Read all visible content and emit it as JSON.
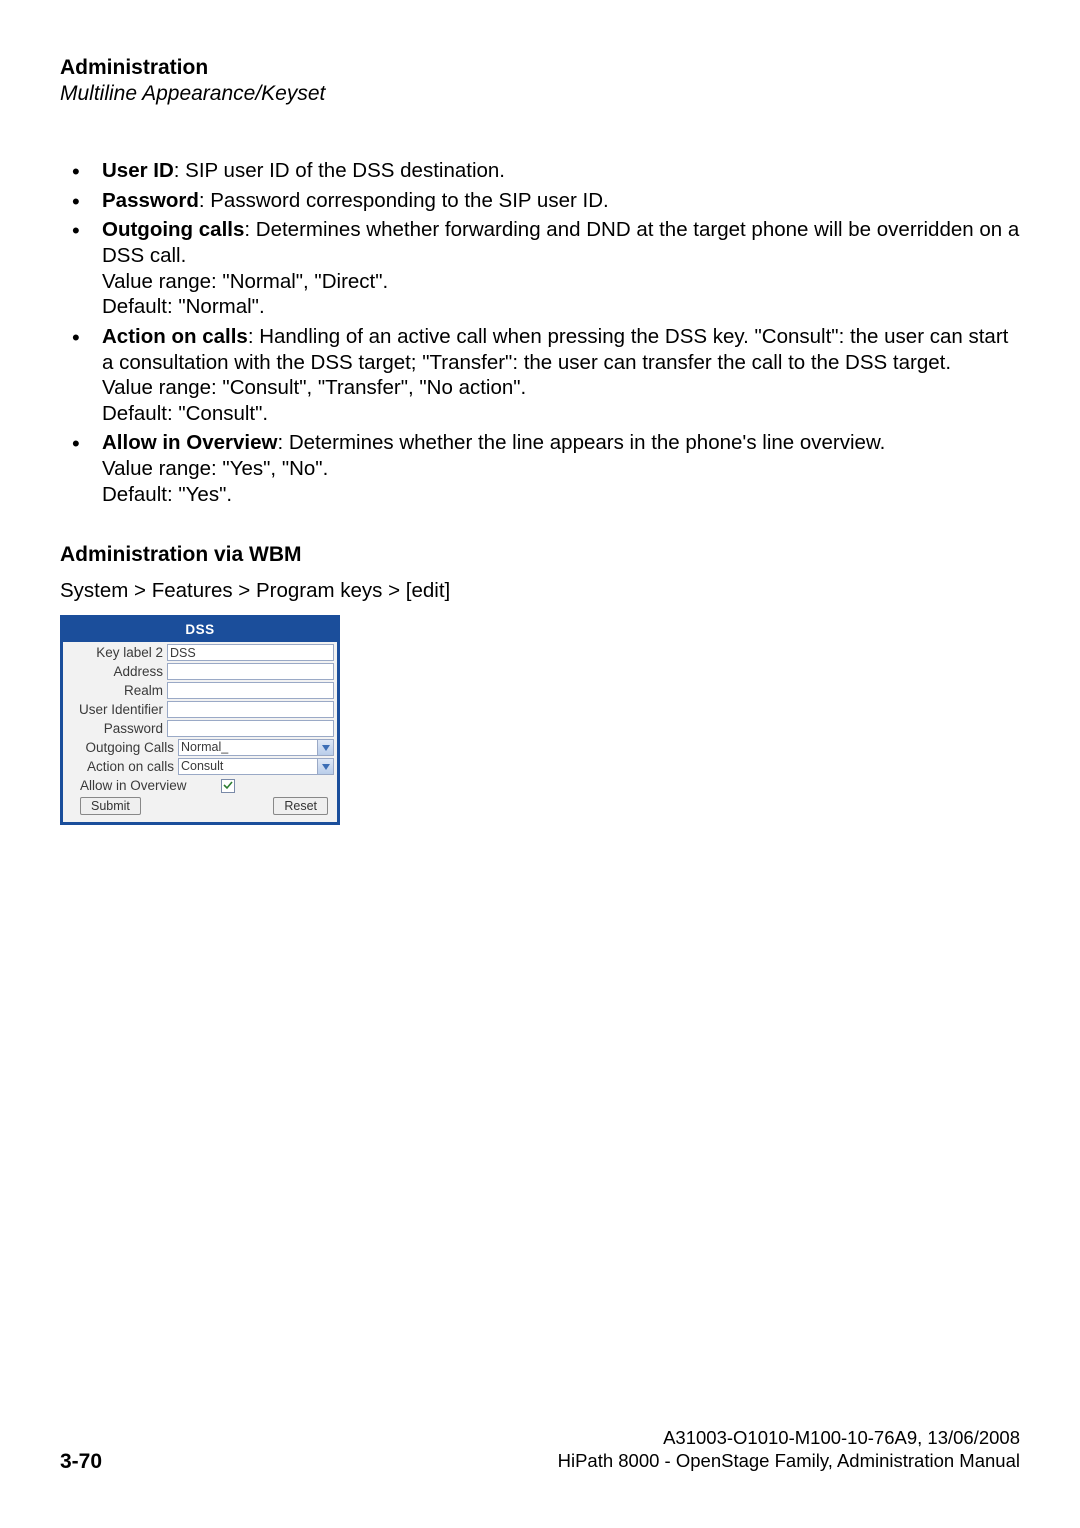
{
  "header": {
    "title": "Administration",
    "subtitle": "Multiline Appearance/Keyset"
  },
  "bullets": [
    {
      "title": "User ID",
      "body": ": SIP user ID of the DSS destination."
    },
    {
      "title": "Password",
      "body": ": Password corresponding to the SIP user ID."
    },
    {
      "title": "Outgoing calls",
      "body": ": Determines whether forwarding and DND at the target phone will be overridden on a DSS call.\nValue range: \"Normal\", \"Direct\".\nDefault: \"Normal\"."
    },
    {
      "title": "Action on calls",
      "body": ": Handling of an active call when pressing the DSS key. \"Consult\": the user can start a consultation with the DSS target; \"Transfer\": the user can transfer the call to the DSS target.\nValue range: \"Consult\", \"Transfer\", \"No action\".\nDefault: \"Consult\"."
    },
    {
      "title": "Allow in Overview",
      "body": ": Determines whether the line appears in the phone's line overview.\nValue range: \"Yes\", \"No\".\nDefault: \"Yes\"."
    }
  ],
  "section_heading": "Administration via WBM",
  "breadcrumb": "System > Features > Program keys > [edit]",
  "dss_panel": {
    "title": "DSS",
    "fields": {
      "key_label_2": {
        "label": "Key label 2",
        "value": "DSS"
      },
      "address": {
        "label": "Address",
        "value": ""
      },
      "realm": {
        "label": "Realm",
        "value": ""
      },
      "user_id": {
        "label": "User Identifier",
        "value": ""
      },
      "password": {
        "label": "Password",
        "value": ""
      },
      "outgoing": {
        "label": "Outgoing Calls",
        "value": "Normal_"
      },
      "action": {
        "label": "Action on calls",
        "value": "Consult"
      },
      "allow": {
        "label": "Allow in Overview",
        "checked": true
      }
    },
    "buttons": {
      "submit": "Submit",
      "reset": "Reset"
    }
  },
  "footer": {
    "doc_id": "A31003-O1010-M100-10-76A9, 13/06/2008",
    "doc_title": "HiPath 8000 - OpenStage Family, Administration Manual",
    "page_number": "3-70"
  }
}
